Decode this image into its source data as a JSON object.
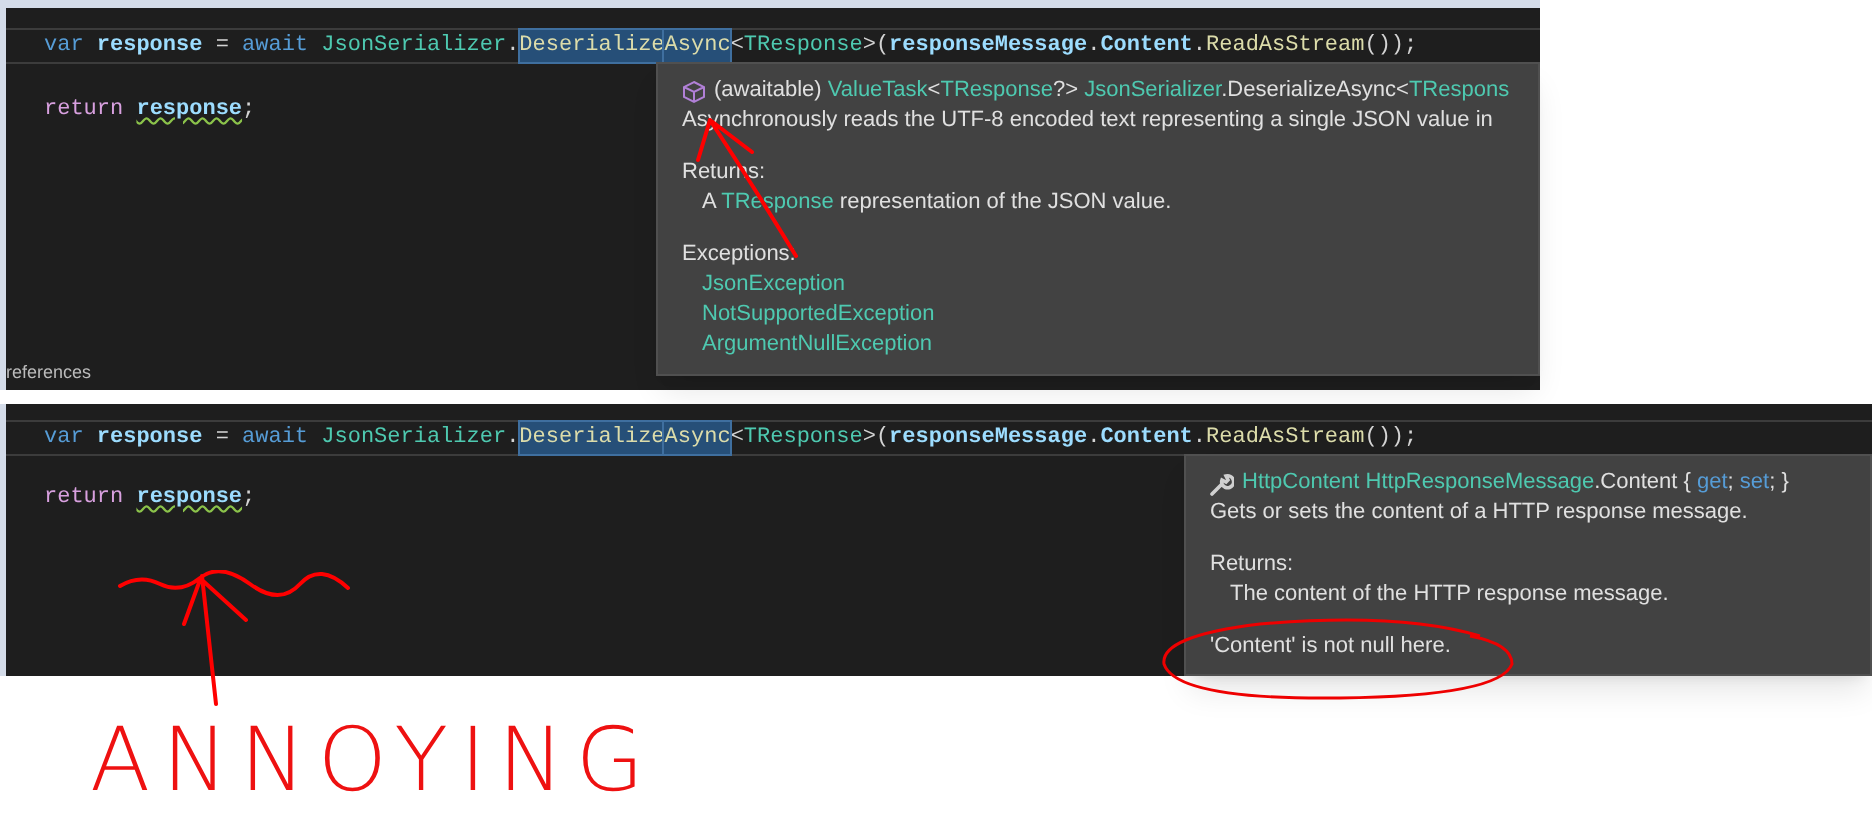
{
  "panels": [
    {
      "code_lines": [
        [
          {
            "t": "var ",
            "kind": "keyword"
          },
          {
            "t": "response",
            "kind": "variable"
          },
          {
            "t": " = ",
            "kind": "plain"
          },
          {
            "t": "await ",
            "kind": "keyword"
          },
          {
            "t": "JsonSerializer",
            "kind": "type"
          },
          {
            "t": ".",
            "kind": "plain"
          },
          {
            "t": "Deserialize",
            "kind": "method",
            "highlighted": true
          },
          {
            "t": "Async",
            "kind": "method",
            "highlighted": true
          },
          {
            "t": "<",
            "kind": "plain"
          },
          {
            "t": "TResponse",
            "kind": "type"
          },
          {
            "t": ">(",
            "kind": "plain"
          },
          {
            "t": "responseMessage",
            "kind": "variable"
          },
          {
            "t": ".",
            "kind": "plain"
          },
          {
            "t": "Content",
            "kind": "variable"
          },
          {
            "t": ".",
            "kind": "plain"
          },
          {
            "t": "ReadAsStream",
            "kind": "method"
          },
          {
            "t": "());",
            "kind": "plain"
          }
        ],
        [
          {
            "t": "return ",
            "kind": "control"
          },
          {
            "t": "response",
            "kind": "variable",
            "squiggle": true
          },
          {
            "t": ";",
            "kind": "plain"
          }
        ]
      ],
      "footer": "references",
      "tooltip": {
        "kind": "method",
        "lines": [
          {
            "kind": "signature",
            "parts": [
              {
                "t": "(awaitable) ",
                "kind": "plain"
              },
              {
                "t": "ValueTask",
                "kind": "type"
              },
              {
                "t": "<",
                "kind": "plain"
              },
              {
                "t": "TResponse",
                "kind": "type"
              },
              {
                "t": "?> ",
                "kind": "plain"
              },
              {
                "t": "JsonSerializer",
                "kind": "type"
              },
              {
                "t": ".DeserializeAsync<",
                "kind": "plain"
              },
              {
                "t": "TRespons",
                "kind": "type"
              }
            ]
          },
          {
            "kind": "text",
            "parts": [
              {
                "t": "Asynchronously reads the UTF-8 encoded text representing a single JSON value in",
                "kind": "plain"
              }
            ]
          },
          {
            "kind": "heading",
            "parts": [
              {
                "t": "Returns:",
                "kind": "plain"
              }
            ]
          },
          {
            "kind": "indent",
            "parts": [
              {
                "t": "A ",
                "kind": "plain"
              },
              {
                "t": "TResponse",
                "kind": "type"
              },
              {
                "t": " representation of the JSON value.",
                "kind": "plain"
              }
            ]
          },
          {
            "kind": "heading",
            "parts": [
              {
                "t": "Exceptions:",
                "kind": "plain"
              }
            ]
          },
          {
            "kind": "indent",
            "parts": [
              {
                "t": "JsonException",
                "kind": "type"
              }
            ]
          },
          {
            "kind": "indent_tight",
            "parts": [
              {
                "t": "NotSupportedException",
                "kind": "type"
              }
            ]
          },
          {
            "kind": "indent_tight",
            "parts": [
              {
                "t": "ArgumentNullException",
                "kind": "type"
              }
            ]
          }
        ]
      }
    },
    {
      "code_lines": [
        [
          {
            "t": "var ",
            "kind": "keyword"
          },
          {
            "t": "response",
            "kind": "variable"
          },
          {
            "t": " = ",
            "kind": "plain"
          },
          {
            "t": "await ",
            "kind": "keyword"
          },
          {
            "t": "JsonSerializer",
            "kind": "type"
          },
          {
            "t": ".",
            "kind": "plain"
          },
          {
            "t": "Deserialize",
            "kind": "method",
            "highlighted": true
          },
          {
            "t": "Async",
            "kind": "method",
            "highlighted": true
          },
          {
            "t": "<",
            "kind": "plain"
          },
          {
            "t": "TResponse",
            "kind": "type"
          },
          {
            "t": ">(",
            "kind": "plain"
          },
          {
            "t": "responseMessage",
            "kind": "variable"
          },
          {
            "t": ".",
            "kind": "plain"
          },
          {
            "t": "Content",
            "kind": "variable"
          },
          {
            "t": ".",
            "kind": "plain"
          },
          {
            "t": "ReadAsStream",
            "kind": "method"
          },
          {
            "t": "());",
            "kind": "plain"
          }
        ],
        [
          {
            "t": "return ",
            "kind": "control"
          },
          {
            "t": "response",
            "kind": "variable",
            "squiggle": true
          },
          {
            "t": ";",
            "kind": "plain"
          }
        ]
      ],
      "tooltip": {
        "kind": "property",
        "lines": [
          {
            "kind": "signature",
            "parts": [
              {
                "t": "HttpContent HttpResponseMessage",
                "kind": "type"
              },
              {
                "t": ".Content { ",
                "kind": "plain"
              },
              {
                "t": "get",
                "kind": "keyword"
              },
              {
                "t": "; ",
                "kind": "plain"
              },
              {
                "t": "set",
                "kind": "keyword"
              },
              {
                "t": "; }",
                "kind": "plain"
              }
            ]
          },
          {
            "kind": "text",
            "parts": [
              {
                "t": "Gets or sets the content of a HTTP response message.",
                "kind": "plain"
              }
            ]
          },
          {
            "kind": "heading",
            "parts": [
              {
                "t": "Returns:",
                "kind": "plain"
              }
            ]
          },
          {
            "kind": "indent",
            "parts": [
              {
                "t": "The content of the HTTP response message.",
                "kind": "plain"
              }
            ]
          },
          {
            "kind": "heading",
            "parts": [
              {
                "t": "'Content' is not null here.",
                "kind": "plain"
              }
            ]
          }
        ]
      }
    }
  ],
  "annotation": "ANNOYING"
}
